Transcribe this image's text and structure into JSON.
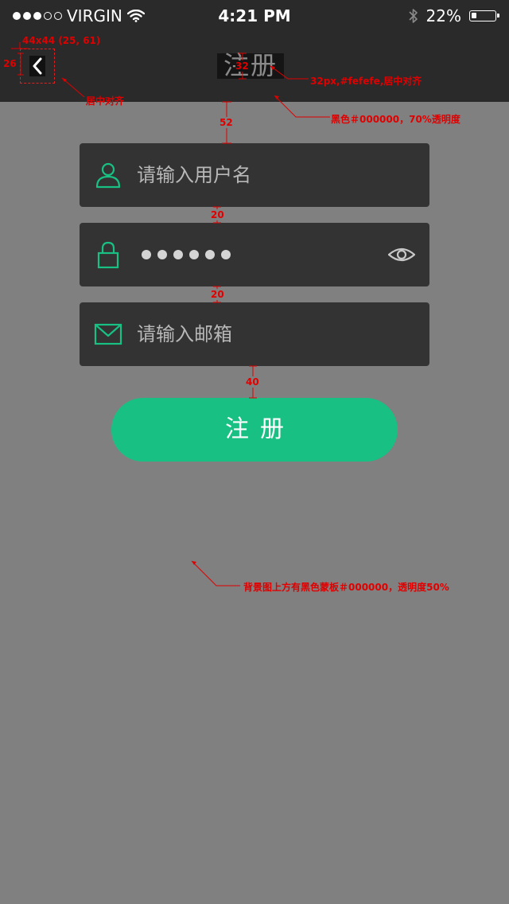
{
  "status_bar": {
    "carrier": "VIRGIN",
    "signal_full": 3,
    "signal_empty": 2,
    "time": "4:21 PM",
    "battery_text": "22%",
    "battery_level": 0.22
  },
  "nav": {
    "title": "注册",
    "back_icon": "chevron-left-icon"
  },
  "form": {
    "username_placeholder": "请输入用户名",
    "password_mask_count": 6,
    "email_placeholder": "请输入邮箱",
    "submit_label": "注册",
    "icons": [
      "user-icon",
      "lock-icon",
      "eye-icon",
      "mail-icon"
    ]
  },
  "colors": {
    "header_bg": "#2a2a2a",
    "page_bg": "#808080",
    "field_bg": "#333333",
    "accent": "#18c083",
    "annotation": "#e00000"
  },
  "annotations": {
    "back_size": "44x44 (25, 61)",
    "back_size_side": "26",
    "back_align": "居中对齐",
    "title_size": "32",
    "title_spec": "32px,#fefefe,居中对齐",
    "header_spec": "黑色＃000000，70%透明度",
    "gap_top": "52",
    "gap_1": "20",
    "gap_2": "20",
    "gap_btn": "40",
    "mask_spec": "背景图上方有黑色蒙板＃000000，透明度50%"
  }
}
